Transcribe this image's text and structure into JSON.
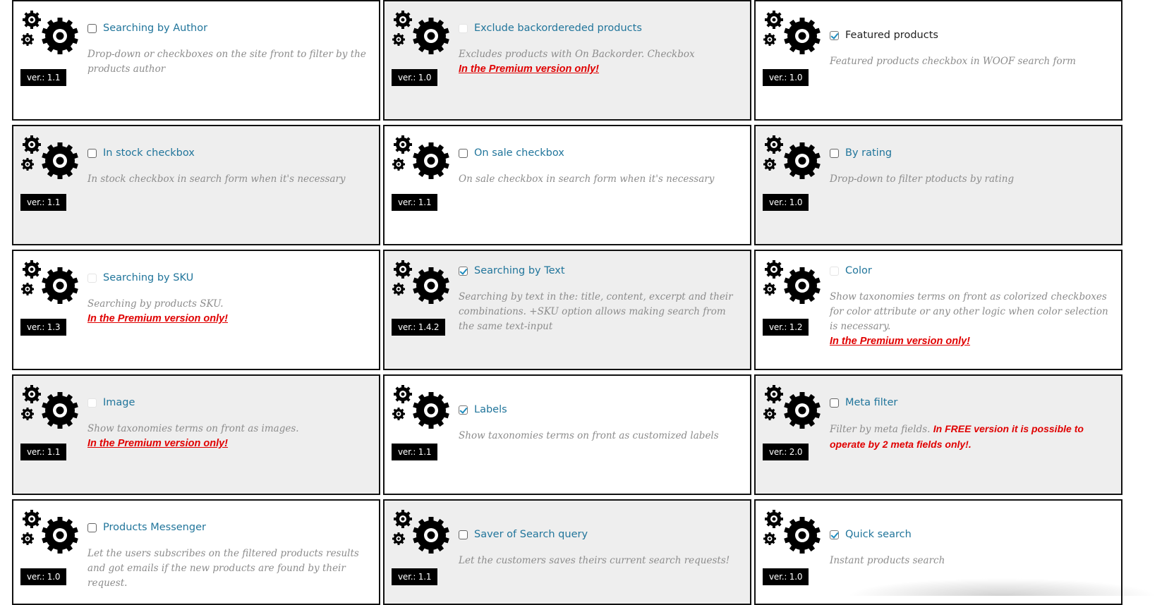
{
  "premium_text": "In the Premium version only!",
  "extensions": [
    {
      "title": "Searching by Author",
      "checkbox": "unchecked",
      "title_color": "link",
      "description": "Drop-down or checkboxes on the site front to filter by the products author",
      "premium": false,
      "warning": "",
      "version": "ver.: 1.1"
    },
    {
      "title": "Exclude backordereded products",
      "checkbox": "faded",
      "title_color": "link",
      "description": "Excludes products with On Backorder. Checkbox",
      "premium": true,
      "warning": "",
      "version": "ver.: 1.0"
    },
    {
      "title": "Featured products",
      "checkbox": "checked",
      "title_color": "dark",
      "description": "Featured products checkbox in WOOF search form",
      "premium": false,
      "warning": "",
      "version": "ver.: 1.0"
    },
    {
      "title": "In stock checkbox",
      "checkbox": "unchecked",
      "title_color": "link",
      "description": "In stock checkbox in search form when it's necessary",
      "premium": false,
      "warning": "",
      "version": "ver.: 1.1"
    },
    {
      "title": "On sale checkbox",
      "checkbox": "unchecked",
      "title_color": "link",
      "description": "On sale checkbox in search form when it's necessary",
      "premium": false,
      "warning": "",
      "version": "ver.: 1.1"
    },
    {
      "title": "By rating",
      "checkbox": "unchecked",
      "title_color": "link",
      "description": "Drop-down to filter ptoducts by rating",
      "premium": false,
      "warning": "",
      "version": "ver.: 1.0"
    },
    {
      "title": "Searching by SKU",
      "checkbox": "faded",
      "title_color": "link",
      "description": "Searching by products SKU.",
      "premium": true,
      "warning": "",
      "version": "ver.: 1.3"
    },
    {
      "title": "Searching by Text",
      "checkbox": "checked",
      "title_color": "link",
      "description": "Searching by text in the: title, content, excerpt and their combinations. +SKU option allows making search from the same text-input",
      "premium": false,
      "warning": "",
      "version": "ver.: 1.4.2"
    },
    {
      "title": "Color",
      "checkbox": "faded",
      "title_color": "link",
      "description": "Show taxonomies terms on front as colorized checkboxes for color attribute or any other logic when color selection is necessary.",
      "premium": true,
      "warning": "",
      "version": "ver.: 1.2"
    },
    {
      "title": "Image",
      "checkbox": "faded",
      "title_color": "link",
      "description": "Show taxonomies terms on front as images.",
      "premium": true,
      "warning": "",
      "version": "ver.: 1.1"
    },
    {
      "title": "Labels",
      "checkbox": "checked",
      "title_color": "link",
      "description": "Show taxonomies terms on front as customized labels",
      "premium": false,
      "warning": "",
      "version": "ver.: 1.1"
    },
    {
      "title": "Meta filter",
      "checkbox": "unchecked",
      "title_color": "link",
      "description": "Filter by meta fields.",
      "premium": false,
      "warning": "In FREE version it is possible to operate by 2 meta fields only!.",
      "version": "ver.: 2.0"
    },
    {
      "title": "Products Messenger",
      "checkbox": "unchecked",
      "title_color": "link",
      "description": "Let the users subscribes on the filtered products results and got emails if the new products are found by their request.",
      "premium": false,
      "warning": "",
      "version": "ver.: 1.0"
    },
    {
      "title": "Saver of Search query",
      "checkbox": "unchecked",
      "title_color": "link",
      "description": "Let the customers saves theirs current search requests!",
      "premium": false,
      "warning": "",
      "version": "ver.: 1.1"
    },
    {
      "title": "Quick search",
      "checkbox": "checked",
      "title_color": "link",
      "description": "Instant products search",
      "premium": false,
      "warning": "",
      "version": "ver.: 1.0"
    }
  ],
  "colors": {
    "link": "#21759b",
    "premium_red": "#e00000",
    "card_gray": "#eeeeee",
    "border": "#111111",
    "checkmark": "#1e8cbe"
  }
}
